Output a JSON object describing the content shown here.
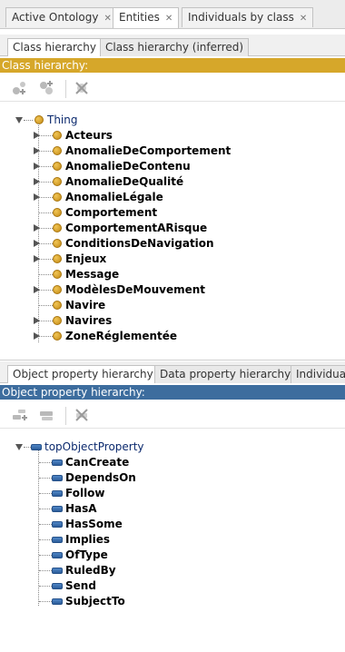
{
  "tabs": [
    {
      "label": "Active Ontology",
      "closable": false,
      "active": false
    },
    {
      "label": "Entities",
      "closable": true,
      "active": true
    },
    {
      "label": "Individuals by class",
      "closable": true,
      "active": false
    }
  ],
  "class_panel": {
    "subtabs": [
      "Class hierarchy",
      "Class hierarchy (inferred)"
    ],
    "header": "Class hierarchy:",
    "toolbar": [
      "add-subclass-icon",
      "add-sibling-class-icon",
      "delete-class-icon"
    ],
    "root": "Thing",
    "items": [
      {
        "label": "Acteurs",
        "expandable": true
      },
      {
        "label": "AnomalieDeComportement",
        "expandable": true
      },
      {
        "label": "AnomalieDeContenu",
        "expandable": true
      },
      {
        "label": "AnomalieDeQualité",
        "expandable": true
      },
      {
        "label": "AnomalieLégale",
        "expandable": true
      },
      {
        "label": "Comportement",
        "expandable": false
      },
      {
        "label": "ComportementARisque",
        "expandable": true
      },
      {
        "label": "ConditionsDeNavigation",
        "expandable": true
      },
      {
        "label": "Enjeux",
        "expandable": true
      },
      {
        "label": "Message",
        "expandable": false
      },
      {
        "label": "ModèlesDeMouvement",
        "expandable": true
      },
      {
        "label": "Navire",
        "expandable": false
      },
      {
        "label": "Navires",
        "expandable": true
      },
      {
        "label": "ZoneRéglementée",
        "expandable": true
      }
    ],
    "colors": {
      "header": "#d6a72a",
      "class_icon": "#e0a82e"
    }
  },
  "property_panel": {
    "subtabs": [
      "Object property hierarchy",
      "Data property hierarchy",
      "Individua"
    ],
    "header": "Object property hierarchy:",
    "toolbar": [
      "add-sub-property-icon",
      "add-sibling-property-icon",
      "delete-property-icon"
    ],
    "root": "topObjectProperty",
    "items": [
      {
        "label": "CanCreate"
      },
      {
        "label": "DependsOn"
      },
      {
        "label": "Follow"
      },
      {
        "label": "HasA"
      },
      {
        "label": "HasSome"
      },
      {
        "label": "Implies"
      },
      {
        "label": "OfType"
      },
      {
        "label": "RuledBy"
      },
      {
        "label": "Send"
      },
      {
        "label": "SubjectTo"
      }
    ],
    "colors": {
      "header": "#3d6d9e",
      "property_icon": "#3a72b5"
    }
  }
}
